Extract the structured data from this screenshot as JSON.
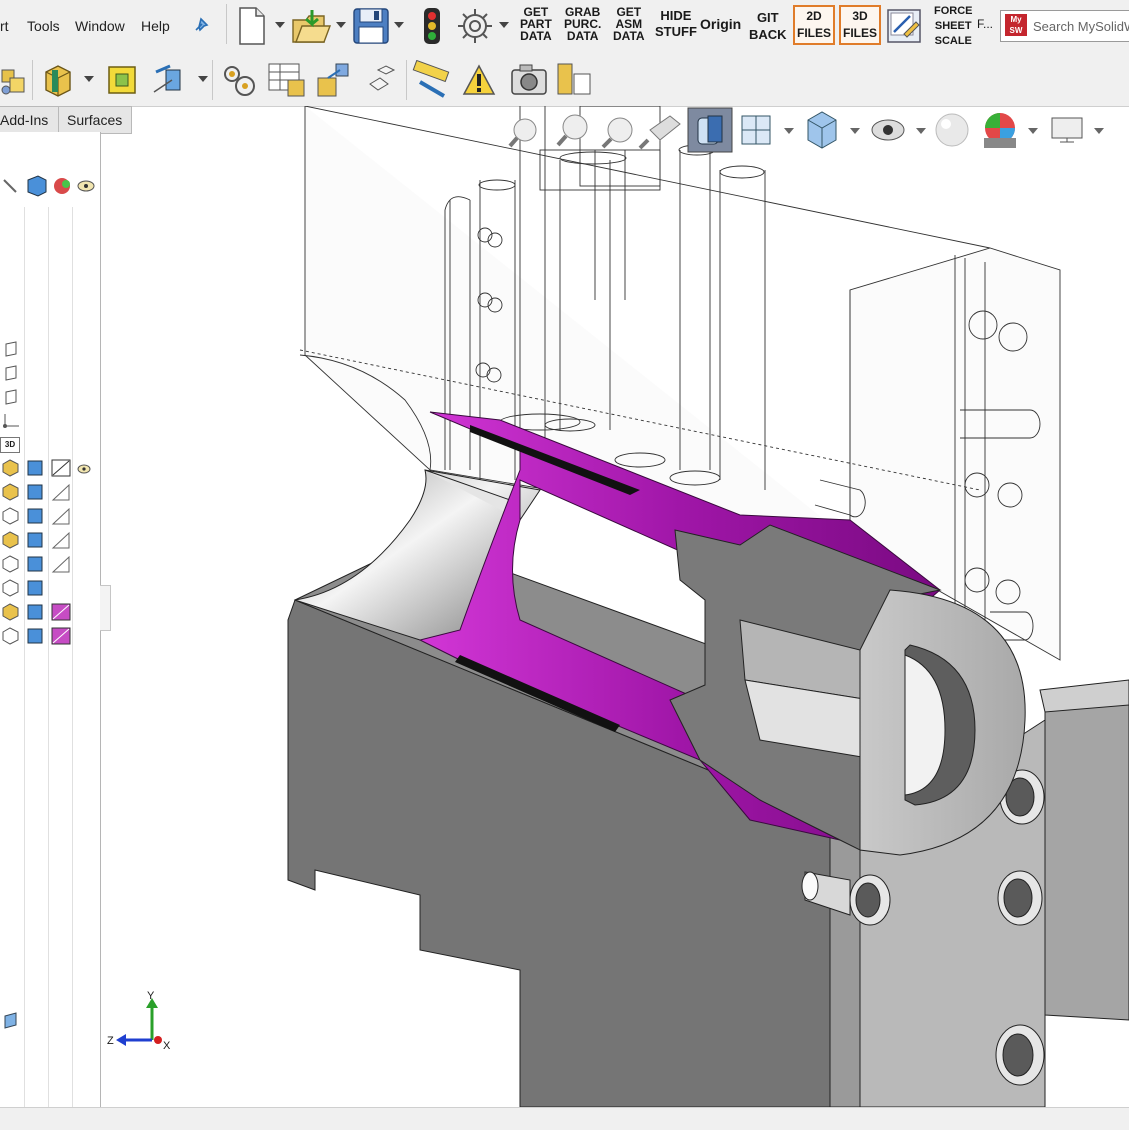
{
  "menu": {
    "items": [
      {
        "label": "rt"
      },
      {
        "label": "Tools"
      },
      {
        "label": "Window"
      },
      {
        "label": "Help"
      }
    ]
  },
  "macros": {
    "get_part_data": "GET\nPART\nDATA",
    "grab_purc_data": "GRAB\nPURC.\nDATA",
    "get_asm_data": "GET\nASM\nDATA",
    "hide_stuff": "HIDE\nSTUFF",
    "origin": "Origin",
    "git_back": "GIT\nBACK",
    "files_2d": "2D\nFILES",
    "files_3d": "3D\nFILES",
    "force_sheet_scale": "FORCE\nSHEET\nSCALE",
    "f_more": "F..."
  },
  "search": {
    "logo_text": "My\nSW",
    "value": "Search MySolidW"
  },
  "tabs": [
    {
      "label": "Add-Ins"
    },
    {
      "label": "Surfaces"
    }
  ],
  "tree": {
    "label_3d": "3D"
  },
  "triad": {
    "y_label": "Y",
    "z_label": "Z",
    "x_label": "X"
  },
  "colors": {
    "accent_purple": "#a016a8",
    "part_gray": "#7a7a7a",
    "highlight_orange": "#e07c2a",
    "axis_green": "#2aa02a",
    "axis_blue": "#1f3fd0",
    "axis_red": "#d42020"
  },
  "icons": {
    "pin": "pin-icon",
    "new": "new-document-icon",
    "open": "open-folder-icon",
    "save": "save-disk-icon",
    "traffic": "traffic-light-icon",
    "options": "gear-icon"
  }
}
